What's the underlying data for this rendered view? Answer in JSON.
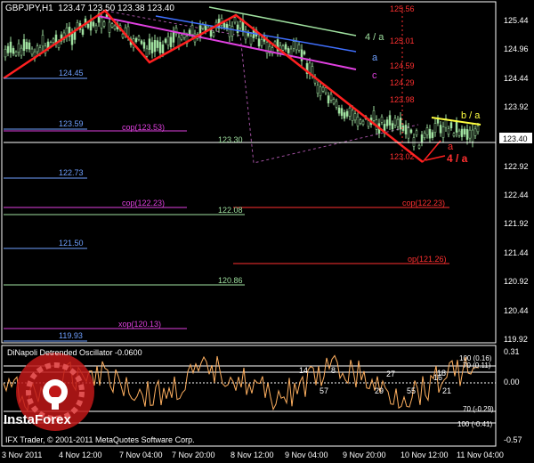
{
  "header": {
    "symbol": "GBPJPY,H1",
    "ohlc": "123.47 123.50 123.38 123.40"
  },
  "price_axis": {
    "labels": [
      "125.44",
      "124.96",
      "124.44",
      "123.92",
      "123.40",
      "122.92",
      "122.44",
      "121.92",
      "121.44",
      "120.92",
      "120.44",
      "119.92"
    ],
    "current_price": "123.40"
  },
  "time_axis": {
    "labels": [
      "3 Nov 2011",
      "4 Nov 12:00",
      "7 Nov 04:00",
      "7 Nov 20:00",
      "8 Nov 12:00",
      "9 Nov 04:00",
      "9 Nov 20:00",
      "10 Nov 12:00",
      "11 Nov 04:00"
    ]
  },
  "levels": [
    {
      "text": "125.56",
      "color": "#ff3030"
    },
    {
      "text": "125.01",
      "color": "#ff3030"
    },
    {
      "text": "124.59",
      "color": "#ff3030"
    },
    {
      "text": "124.29",
      "color": "#ff3030"
    },
    {
      "text": "123.98",
      "color": "#ff3030"
    },
    {
      "text": "123.02",
      "color": "#ff3030"
    },
    {
      "text": "124.45",
      "color": "#6fa0ff"
    },
    {
      "text": "123.59",
      "color": "#6fa0ff"
    },
    {
      "text": "cop(123.53)",
      "color": "#e040e0"
    },
    {
      "text": "123.30",
      "color": "#9fe09f"
    },
    {
      "text": "122.73",
      "color": "#6fa0ff"
    },
    {
      "text": "cop(122.23)",
      "color": "#e040e0"
    },
    {
      "text": "122.08",
      "color": "#9fe09f"
    },
    {
      "text": "cop(122.23)",
      "color": "#ff3030"
    },
    {
      "text": "121.50",
      "color": "#6fa0ff"
    },
    {
      "text": "op(121.26)",
      "color": "#ff3030"
    },
    {
      "text": "120.86",
      "color": "#9fe09f"
    },
    {
      "text": "xop(120.13)",
      "color": "#e040e0"
    },
    {
      "text": "119.93",
      "color": "#6fa0ff"
    }
  ],
  "wave_labels": [
    {
      "text": "4 / a",
      "color": "#9fe09f"
    },
    {
      "text": "a",
      "color": "#6fa0ff"
    },
    {
      "text": "c",
      "color": "#e040e0"
    },
    {
      "text": "b / a",
      "color": "#ffff40"
    },
    {
      "text": "a",
      "color": "#ff3030"
    },
    {
      "text": "4 / a",
      "color": "#ff3030"
    }
  ],
  "oscillator": {
    "title": "DiNapoli Detrended Oscillator -0.0600",
    "scale": [
      "0.31",
      "100 (0.16)",
      "70 (0.11)",
      "0.00",
      "70 (-0.29)",
      "100 (-0.41)",
      "-0.57"
    ],
    "numbers": [
      "14",
      "8",
      "57",
      "27",
      "29",
      "55",
      "18",
      "21",
      "16"
    ]
  },
  "footer": {
    "copyright": "IFX Trader, © 2001-2011 MetaQuotes Software Corp.",
    "logo_text": "InstaForex"
  },
  "colors": {
    "background": "#000000",
    "grid": "#ffffff",
    "candle": "#9fe09f",
    "wave_red": "#ff2020",
    "wave_magenta": "#e040e0",
    "osc_line": "#ffb060"
  }
}
